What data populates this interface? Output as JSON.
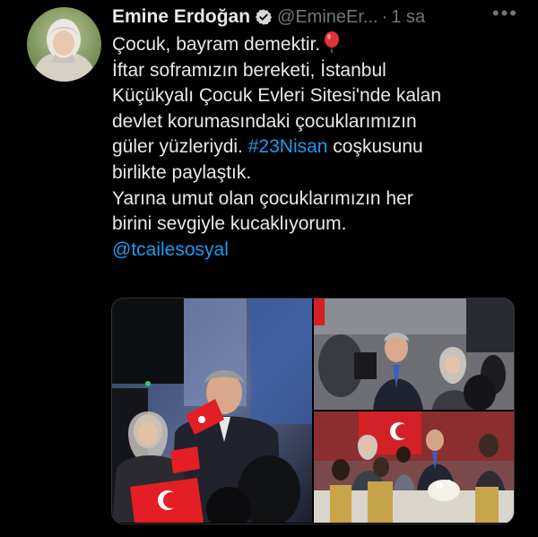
{
  "author": {
    "name": "Emine Erdoğan",
    "handle": "@EmineEr...",
    "separator": "·",
    "time": "1 sa",
    "verified": true,
    "avatar_icon": "profile-photo"
  },
  "menu": {
    "more_label": "•••"
  },
  "tweet": {
    "line1": "Çocuk, bayram demektir.",
    "line1_emoji": "balloon-emoji",
    "line2": "İftar soframızın bereketi, İstanbul",
    "line3": "Küçükyalı Çocuk Evleri Sitesi'nde kalan",
    "line4": "devlet korumasındaki çocuklarımızın",
    "line5_a": "güler yüzleriydi. ",
    "hashtag": "#23Nisan",
    "line5_b": " coşkusunu",
    "line6": "birlikte paylaştık.",
    "line7": "Yarına umut olan çocuklarımızın her",
    "line8": "birini sevgiyle kucaklıyorum.",
    "mention": "@tcailesosyal"
  },
  "media": {
    "photos": [
      {
        "name": "photo-1",
        "alt": "event-photo-children-flags"
      },
      {
        "name": "photo-2",
        "alt": "event-photo-greeting"
      },
      {
        "name": "photo-3",
        "alt": "event-photo-iftar-table"
      }
    ]
  },
  "colors": {
    "background": "#000000",
    "text": "#e7e9ea",
    "secondary": "#71767b",
    "link": "#1d9bf0",
    "verified": "#d9d9d9"
  }
}
